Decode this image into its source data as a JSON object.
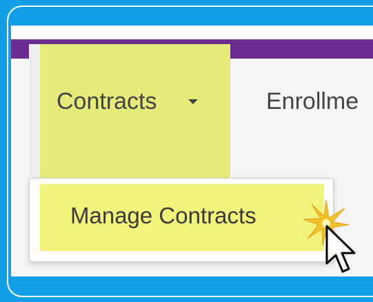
{
  "nav": {
    "contracts_label": "Contracts",
    "enrollment_label": "Enrollme"
  },
  "dropdown": {
    "items": [
      {
        "label": "Manage Contracts"
      }
    ]
  },
  "colors": {
    "frame": "#11a0e8",
    "topbar": "#6b2d91",
    "highlight": "#e6ea79",
    "text": "#444444"
  },
  "icons": {
    "caret": "caret-down-icon",
    "sparkle": "click-sparkle-icon",
    "cursor": "mouse-pointer-icon"
  }
}
